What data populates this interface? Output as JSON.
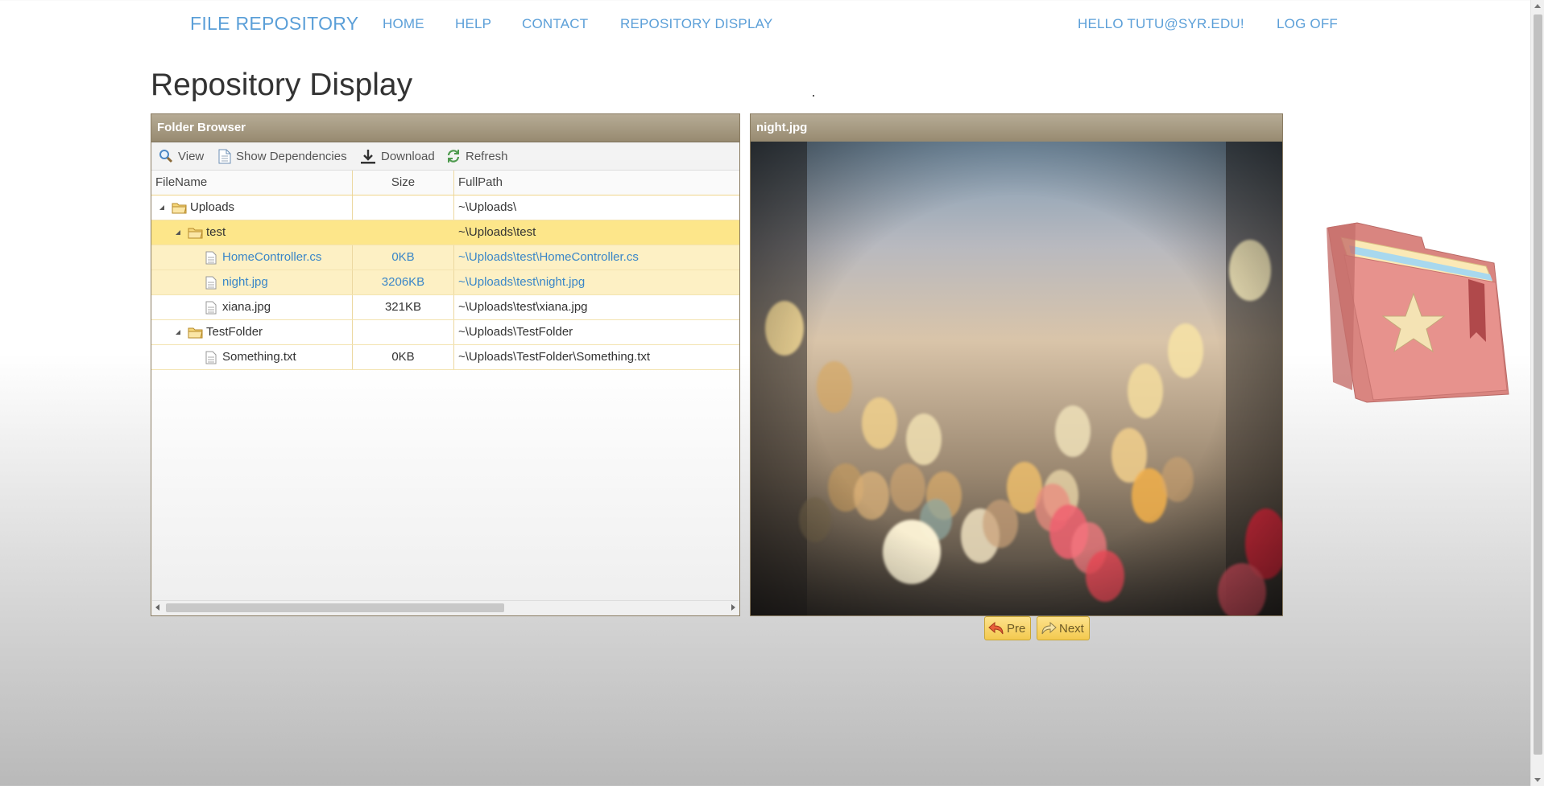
{
  "nav": {
    "brand": "FILE REPOSITORY",
    "links": [
      "HOME",
      "HELP",
      "CONTACT",
      "REPOSITORY DISPLAY"
    ],
    "greeting": "HELLO TUTU@SYR.EDU!",
    "logoff": "LOG OFF"
  },
  "page": {
    "title": "Repository Display"
  },
  "folder_browser": {
    "title": "Folder Browser",
    "toolbar": {
      "view": "View",
      "show_dependencies": "Show Dependencies",
      "download": "Download",
      "refresh": "Refresh"
    },
    "columns": {
      "name": "FileName",
      "size": "Size",
      "path": "FullPath"
    },
    "rows": [
      {
        "name": "Uploads",
        "size": "",
        "path": "~\\Uploads\\"
      },
      {
        "name": "test",
        "size": "",
        "path": "~\\Uploads\\test"
      },
      {
        "name": "HomeController.cs",
        "size": "0KB",
        "path": "~\\Uploads\\test\\HomeController.cs"
      },
      {
        "name": "night.jpg",
        "size": "3206KB",
        "path": "~\\Uploads\\test\\night.jpg"
      },
      {
        "name": "xiana.jpg",
        "size": "321KB",
        "path": "~\\Uploads\\test\\xiana.jpg"
      },
      {
        "name": "TestFolder",
        "size": "",
        "path": "~\\Uploads\\TestFolder"
      },
      {
        "name": "Something.txt",
        "size": "0KB",
        "path": "~\\Uploads\\TestFolder\\Something.txt"
      }
    ]
  },
  "preview": {
    "title": "night.jpg",
    "pre_label": "Pre",
    "next_label": "Next"
  },
  "colors": {
    "link": "#5b9fd8",
    "panel_header": "#a89c84",
    "selected_row": "#fde68a",
    "highlight_row": "#fdf0c4"
  }
}
